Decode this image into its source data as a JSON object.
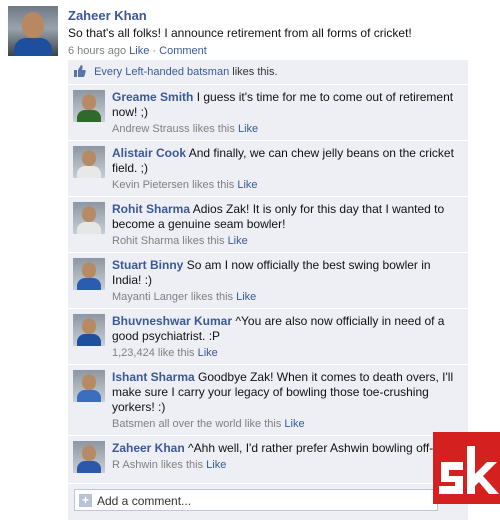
{
  "post": {
    "author": "Zaheer Khan",
    "status": "So that's all folks! I announce retirement from all forms of cricket!",
    "time": "6 hours ago",
    "like_label": "Like",
    "separator": "·",
    "comment_label": "Comment"
  },
  "likes": {
    "likers": "Every Left-handed batsman",
    "suffix": "likes this."
  },
  "comments": [
    {
      "name": "Greame Smith",
      "text": "I guess it's time for me to come out of retirement now! ;)",
      "likes_text": "Andrew Strauss likes this",
      "like_label": "Like",
      "shirt_color": "#2e6b2a"
    },
    {
      "name": "Alistair Cook",
      "text": "And finally, we can chew jelly beans on the cricket field. ;)",
      "likes_text": "Kevin Pietersen likes this",
      "like_label": "Like",
      "shirt_color": "#e8e8e8"
    },
    {
      "name": "Rohit Sharma",
      "text": "Adios Zak! It is only for this day that I wanted to become a genuine seam bowler!",
      "likes_text": "Rohit Sharma likes this",
      "like_label": "Like",
      "shirt_color": "#e6e6e6"
    },
    {
      "name": "Stuart Binny",
      "text": "So am I now officially the best swing bowler in India! :)",
      "likes_text": "Mayanti Langer likes this",
      "like_label": "Like",
      "shirt_color": "#2a5db0"
    },
    {
      "name": "Bhuvneshwar Kumar",
      "text": "^You are also now officially in need of a good psychiatrist. :P",
      "likes_text": "1,23,424 like this",
      "like_label": "Like",
      "shirt_color": "#1f4f9f"
    },
    {
      "name": "Ishant Sharma",
      "text": "Goodbye Zak! When it comes to death overs, I'll make sure I carry your legacy of bowling those toe-crushing yorkers! :)",
      "likes_text": "Batsmen all over the world like this",
      "like_label": "Like",
      "shirt_color": "#3a6fc0"
    },
    {
      "name": "Zaheer Khan",
      "text": "^Ahh well, I'd rather prefer Ashwin bowling off-spin!",
      "likes_text": "R Ashwin likes this",
      "like_label": "Like",
      "shirt_color": "#2b58a8"
    }
  ],
  "add_comment": {
    "placeholder": "Add a comment..."
  },
  "logo": {
    "text": "sk",
    "color": "#d42120"
  }
}
